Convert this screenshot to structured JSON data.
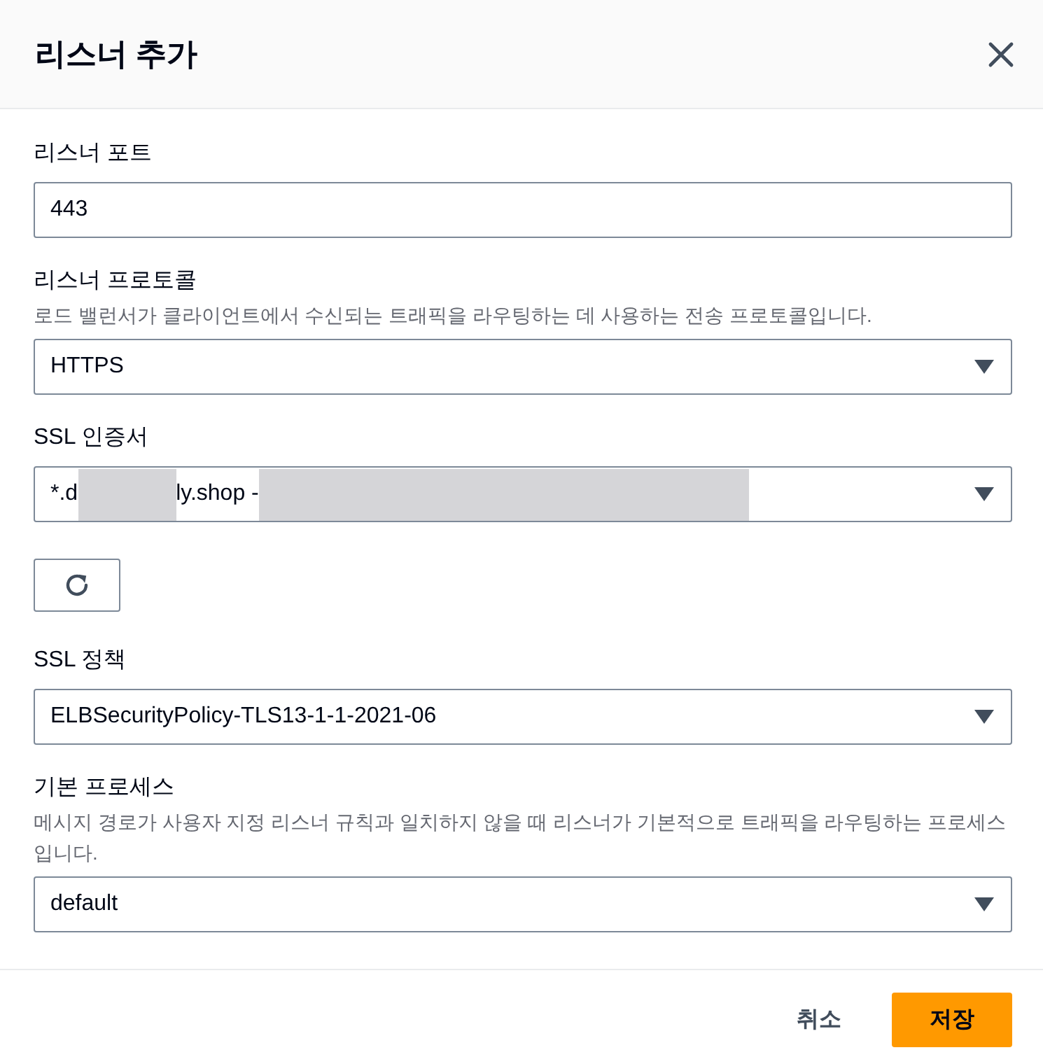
{
  "dialog": {
    "title": "리스너 추가"
  },
  "fields": [
    {
      "kind": "input",
      "label": "리스너 포트",
      "value": "443"
    },
    {
      "kind": "select",
      "label": "리스너 프로토콜",
      "description": "로드 밸런서가 클라이언트에서 수신되는 트래픽을 라우팅하는 데 사용하는 전송 프로토콜입니다.",
      "value": "HTTPS"
    },
    {
      "kind": "select",
      "label": "SSL 인증서",
      "value_parts": [
        {
          "kind": "text",
          "text": "*.d"
        },
        {
          "kind": "redacted"
        },
        {
          "kind": "text",
          "text": "ly.shop -"
        },
        {
          "kind": "redacted"
        }
      ]
    },
    {
      "kind": "refresh"
    },
    {
      "kind": "select",
      "label": "SSL 정책",
      "value": "ELBSecurityPolicy-TLS13-1-1-2021-06"
    },
    {
      "kind": "select",
      "label": "기본 프로세스",
      "description": "메시지 경로가 사용자 지정 리스너 규칙과 일치하지 않을 때 리스너가 기본적으로 트래픽을 라우팅하는 프로세스입니다.",
      "value": "default"
    }
  ],
  "footer": {
    "buttons": [
      {
        "kind": "link",
        "label": "취소"
      },
      {
        "kind": "primary",
        "label": "저장"
      }
    ]
  }
}
